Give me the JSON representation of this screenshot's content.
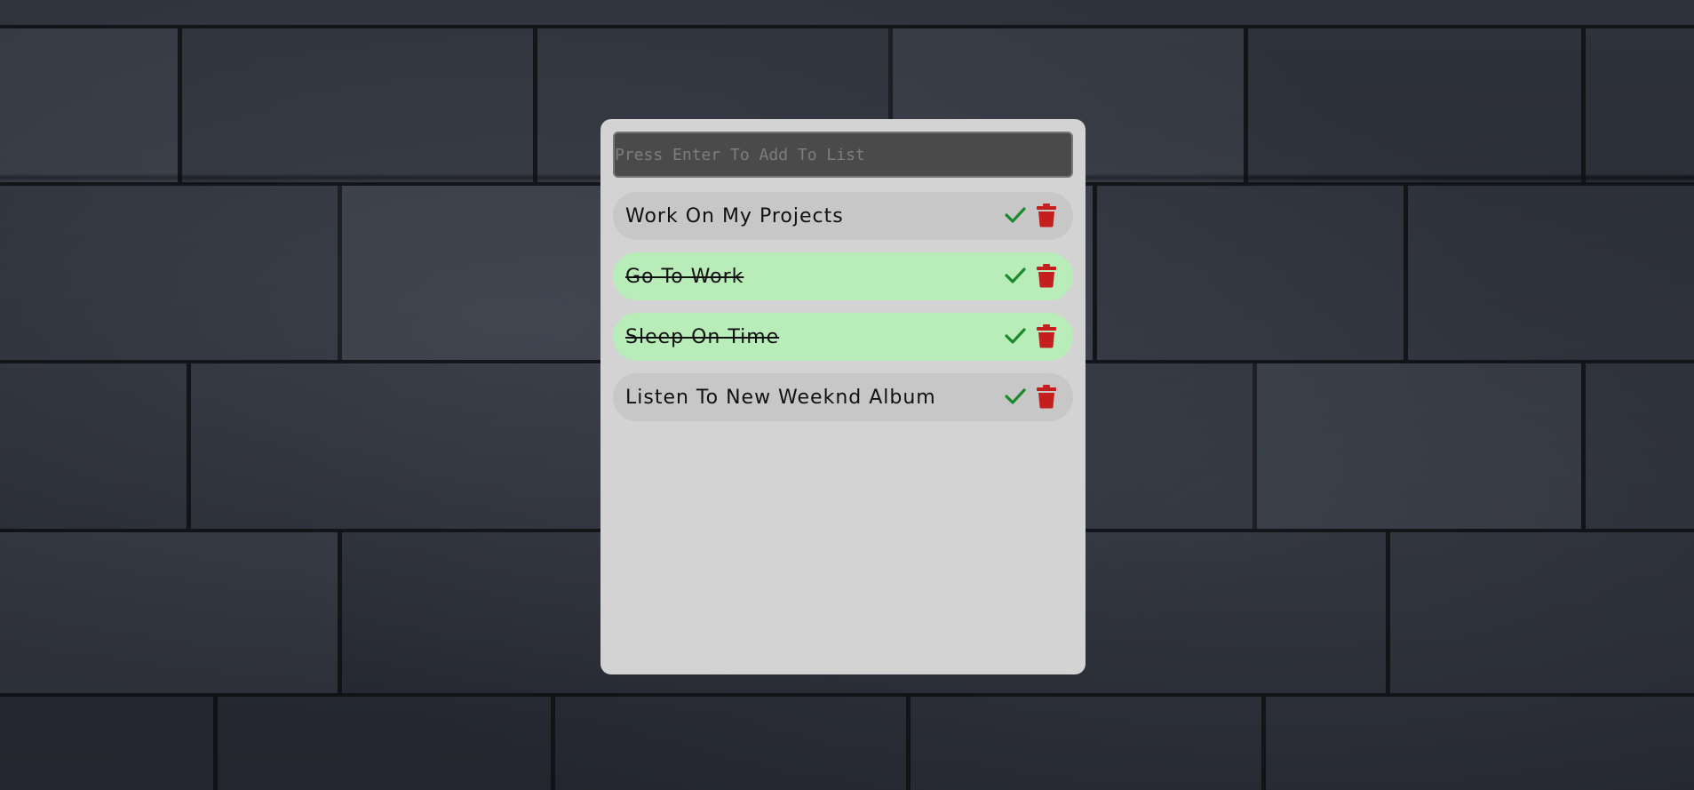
{
  "input": {
    "placeholder": "Press Enter To Add To List",
    "value": ""
  },
  "todos": [
    {
      "text": "Work On My Projects",
      "completed": false
    },
    {
      "text": "Go To Work",
      "completed": true
    },
    {
      "text": "Sleep On Time",
      "completed": true
    },
    {
      "text": "Listen To New Weeknd Album",
      "completed": false
    }
  ],
  "colors": {
    "panel_background": "#d3d3d3",
    "input_background": "#4a4a4a",
    "item_background": "#c7c7c7",
    "completed_item_background": "#b8ecb8",
    "check_icon": "#1a8a2a",
    "trash_icon": "#c41e1e",
    "page_background": "#2a2e37"
  },
  "icons": {
    "complete": "check-icon",
    "delete": "trash-icon"
  }
}
